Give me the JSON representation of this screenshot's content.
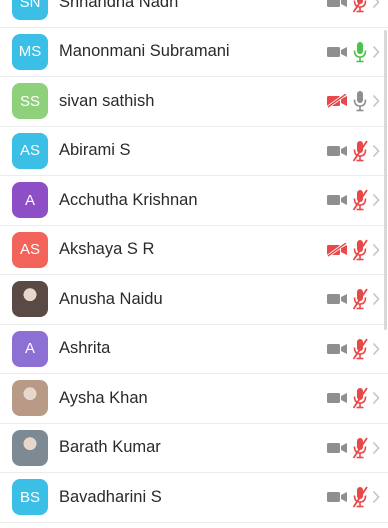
{
  "participants": [
    {
      "initials": "SN",
      "name": "Srinandha Nadh",
      "avatar_color": "#3bbfe6",
      "avatar_type": "initials",
      "video": "on",
      "mic": "muted"
    },
    {
      "initials": "MS",
      "name": "Manonmani Subramani",
      "avatar_color": "#3bbfe6",
      "avatar_type": "initials",
      "video": "on",
      "mic": "on"
    },
    {
      "initials": "SS",
      "name": "sivan sathish",
      "avatar_color": "#8fd17a",
      "avatar_type": "initials",
      "video": "off",
      "mic": "idle"
    },
    {
      "initials": "AS",
      "name": "Abirami S",
      "avatar_color": "#3bbfe6",
      "avatar_type": "initials",
      "video": "on",
      "mic": "muted"
    },
    {
      "initials": "A",
      "name": "Acchutha Krishnan",
      "avatar_color": "#8e4fc6",
      "avatar_type": "initials",
      "video": "on",
      "mic": "muted"
    },
    {
      "initials": "AS",
      "name": "Akshaya S R",
      "avatar_color": "#f2645a",
      "avatar_type": "initials",
      "video": "off",
      "mic": "muted"
    },
    {
      "initials": "",
      "name": "Anusha Naidu",
      "avatar_color": "#5a4a46",
      "avatar_type": "photo",
      "video": "on",
      "mic": "muted"
    },
    {
      "initials": "A",
      "name": "Ashrita",
      "avatar_color": "#8e6fd3",
      "avatar_type": "initials",
      "video": "on",
      "mic": "muted"
    },
    {
      "initials": "",
      "name": "Aysha Khan",
      "avatar_color": "#b89a86",
      "avatar_type": "photo",
      "video": "on",
      "mic": "muted"
    },
    {
      "initials": "",
      "name": "Barath Kumar",
      "avatar_color": "#7d8a94",
      "avatar_type": "photo",
      "video": "on",
      "mic": "muted"
    },
    {
      "initials": "BS",
      "name": "Bavadharini S",
      "avatar_color": "#3bbfe6",
      "avatar_type": "initials",
      "video": "on",
      "mic": "muted"
    }
  ],
  "colors": {
    "video_on": "#8f8f8f",
    "video_off": "#e84848",
    "mic_on": "#4cc24c",
    "mic_idle": "#8f8f8f",
    "mic_muted": "#e84848",
    "chevron": "#c4c4c4"
  }
}
